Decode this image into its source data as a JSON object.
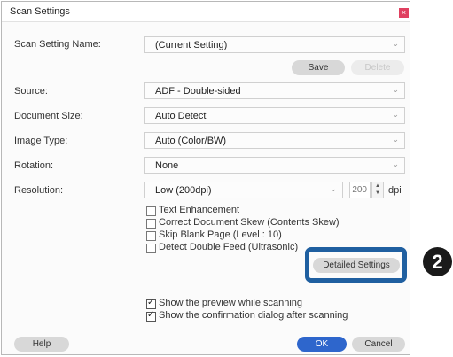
{
  "window": {
    "title": "Scan Settings",
    "close_glyph": "×"
  },
  "scan_setting_name": {
    "label": "Scan Setting Name:",
    "value": "(Current Setting)"
  },
  "buttons": {
    "save": "Save",
    "delete": "Delete",
    "detailed": "Detailed Settings",
    "help": "Help",
    "ok": "OK",
    "cancel": "Cancel"
  },
  "source": {
    "label": "Source:",
    "value": "ADF - Double-sided"
  },
  "document_size": {
    "label": "Document Size:",
    "value": "Auto Detect"
  },
  "image_type": {
    "label": "Image Type:",
    "value": "Auto (Color/BW)"
  },
  "rotation": {
    "label": "Rotation:",
    "value": "None"
  },
  "resolution": {
    "label": "Resolution:",
    "value": "Low (200dpi)",
    "number": "200",
    "unit": "dpi"
  },
  "options": [
    {
      "label": "Text Enhancement",
      "checked": false
    },
    {
      "label": "Correct Document Skew (Contents Skew)",
      "checked": false
    },
    {
      "label": "Skip Blank Page (Level : 10)",
      "checked": false
    },
    {
      "label": "Detect Double Feed (Ultrasonic)",
      "checked": false
    }
  ],
  "preview_options": [
    {
      "label": "Show the preview while scanning",
      "checked": true
    },
    {
      "label": "Show the confirmation dialog after scanning",
      "checked": true
    }
  ],
  "callout": {
    "number": "2"
  },
  "colors": {
    "highlight": "#1f5fa0",
    "ok": "#2e66cc",
    "callout": "#1a1a1a"
  },
  "icons": {
    "chevron": "chevron-down-icon",
    "spinner": "spinner-arrows-icon",
    "check": "checkmark-icon"
  }
}
